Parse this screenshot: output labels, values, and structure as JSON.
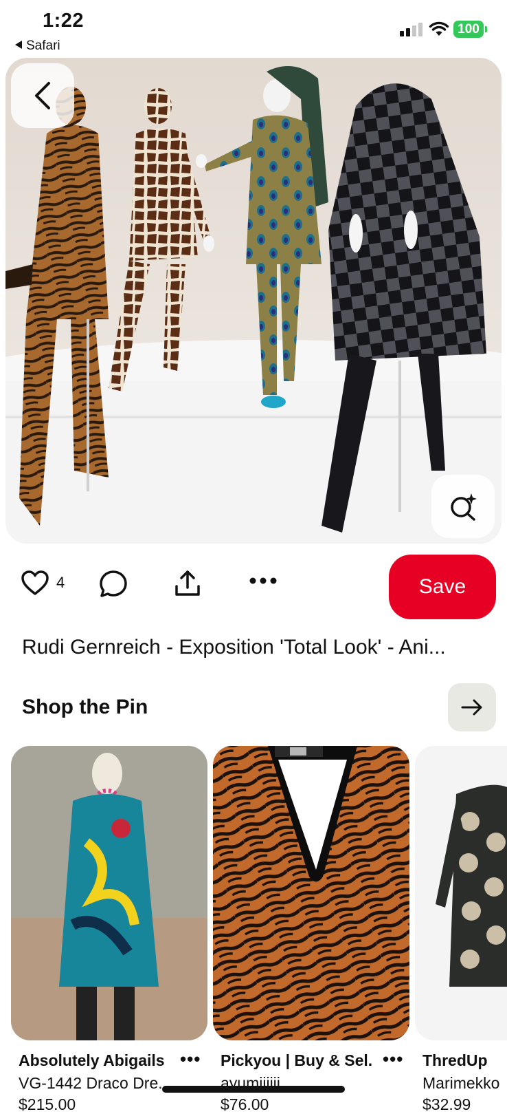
{
  "status_bar": {
    "time": "1:22",
    "back_app": "Safari",
    "battery": "100"
  },
  "pin": {
    "like_count": "4",
    "save_label": "Save",
    "title": "Rudi Gernreich - Exposition 'Total Look' - Ani..."
  },
  "shop": {
    "heading": "Shop the Pin",
    "products": [
      {
        "seller": "Absolutely Abigails",
        "name": "VG-1442 Draco Dre...",
        "price": "$215.00"
      },
      {
        "seller": "Pickyou | Buy & Sel...",
        "name": "ayumiiiiii",
        "price": "$76.00"
      },
      {
        "seller": "ThredUp",
        "name": "Marimekko",
        "price": "$32.99"
      }
    ]
  },
  "icons": {
    "back": "chevron-left-icon",
    "visual_search": "lens-sparkle-icon",
    "like": "heart-icon",
    "comment": "comment-icon",
    "share": "share-icon",
    "more": "more-icon",
    "shop_arrow": "arrow-right-icon"
  },
  "colors": {
    "save_button": "#e60023",
    "battery": "#34c759"
  }
}
